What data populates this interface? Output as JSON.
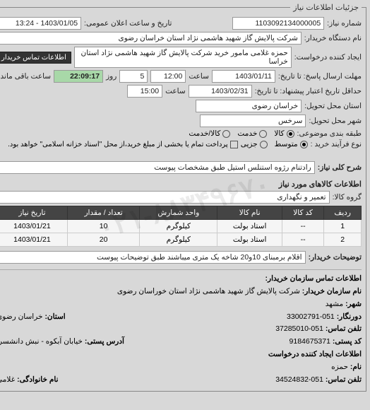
{
  "legend": "جزئیات اطلاعات نیاز",
  "fields": {
    "req_no_label": "شماره نیاز:",
    "req_no": "1103092134000005",
    "ann_date_label": "تاریخ و ساعت اعلان عمومی:",
    "ann_date": "1403/01/05 - 13:24",
    "buyer_org_label": "نام دستگاه خریدار:",
    "buyer_org": "شرکت پالایش گاز شهید هاشمی نژاد   استان خراسان رضوی",
    "creator_label": "ایجاد کننده درخواست:",
    "creator": "حمزه غلامی مامور خرید شرکت پالایش گاز شهید هاشمی نژاد   استان خراسا",
    "contact_btn": "اطلاعات تماس خریدار",
    "deadline_from_label": "مهلت ارسال پاسخ: تا تاریخ:",
    "deadline_from_date": "1403/01/11",
    "deadline_from_time_label": "ساعت",
    "deadline_from_time": "12:00",
    "days_label": "روز",
    "days": "5",
    "remaining_label": "ساعت باقی مانده",
    "remaining": "22:09:17",
    "validity_label": "حداقل تاریخ اعتبار پیشنهاد: تا تاریخ:",
    "validity_date": "1403/02/31",
    "validity_time_label": "ساعت",
    "validity_time": "15:00",
    "needed_state_label": "استان محل تحویل:",
    "needed_state": "خراسان رضوی",
    "needed_city_label": "شهر محل تحویل:",
    "needed_city": "سرخس",
    "category_label": "طبقه بندی موضوعی:",
    "cat_goods": "کالا",
    "cat_service": "خدمت",
    "cat_goods_service": "کالا/خدمت",
    "process_label": "نوع فرآیند خرید :",
    "proc_mid": "متوسط",
    "proc_small": "جزیی",
    "process_note": "پرداخت تمام یا بخشی از مبلغ خرید،از محل \"اسناد خزانه اسلامی\" خواهد بود.",
    "desc_label": "شرح کلی نیاز:",
    "desc": "رادتنام رژوه استنلس استیل طبق مشخصات پیوست",
    "items_header": "اطلاعات کالاهای مورد نیاز",
    "group_label": "گروه کالا:",
    "group": "تعمیر و نگهداری",
    "buyer_notes_label": "توضیحات خریدار:",
    "buyer_notes": "اقلام برمبنای 10و20 شاخه یک متری میباشند طبق توضیحات پیوست"
  },
  "table": {
    "headers": [
      "ردیف",
      "کد کالا",
      "نام کالا",
      "واحد شمارش",
      "تعداد / مقدار",
      "تاریخ نیاز"
    ],
    "rows": [
      [
        "1",
        "--",
        "استاد بولت",
        "کیلوگرم",
        "10",
        "1403/01/21"
      ],
      [
        "2",
        "--",
        "استاد بولت",
        "کیلوگرم",
        "20",
        "1403/01/21"
      ]
    ]
  },
  "contact": {
    "header": "اطلاعات تماس سازمان خریدار:",
    "org_label": "نام سازمان خریدار:",
    "org": "شرکت پالایش گاز شهید هاشمی نژاد استان خوراسان رضوی",
    "city_label": "شهر:",
    "city": "مشهد",
    "province_label": "استان:",
    "province": "خراسان رضوی",
    "fax_label": "دورنگار:",
    "fax": "051-33002791",
    "phone_label": "تلفن تماس:",
    "phone": "051-37285010",
    "address_label": "آدرس پستی:",
    "address": "خیابان آبکوه - نبش دانشسرا",
    "postal_label": "کد پستی:",
    "postal": "9184675371",
    "req_creator_header": "اطلاعات ایجاد کننده درخواست",
    "first_label": "نام:",
    "first": "حمزه",
    "last_label": "نام خانوادگی:",
    "last": "غلامی",
    "creator_phone_label": "تلفن تماس:",
    "creator_phone": "051-34524832"
  }
}
